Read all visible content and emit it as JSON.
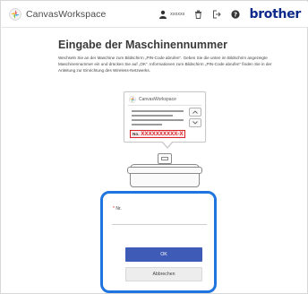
{
  "header": {
    "app_name": "CanvasWorkspace",
    "user_name": "xxxxxx",
    "brand": "brother",
    "icons": [
      "user-icon",
      "trash-icon",
      "logout-icon",
      "help-icon"
    ]
  },
  "main": {
    "title": "Eingabe der Maschinennummer",
    "description": "Wechseln Sie an der Maschine zum Bildschirm „PIN-Code abrufen“. Geben Sie die unten im Bildschirm angezeigte Maschinennummer ein und drücken Sie auf „OK“. Informationen zum Bildschirm „PIN-Code abrufen“ finden Sie in der Anleitung zur Einrichtung des Wireless-Netzwerks."
  },
  "illustration": {
    "app_name": "CanvasWorkspace",
    "serial_prefix": "No.",
    "serial_value": "XXXXXXXXXX-X"
  },
  "form": {
    "field_label": "Nr.",
    "required_mark": "*",
    "field_value": "",
    "ok_label": "OK",
    "cancel_label": "Abbrechen"
  },
  "colors": {
    "brand": "#0d2a8a",
    "highlight": "#1f75e0",
    "primary_button": "#3e5bb8",
    "serial_red": "#d8242b"
  }
}
